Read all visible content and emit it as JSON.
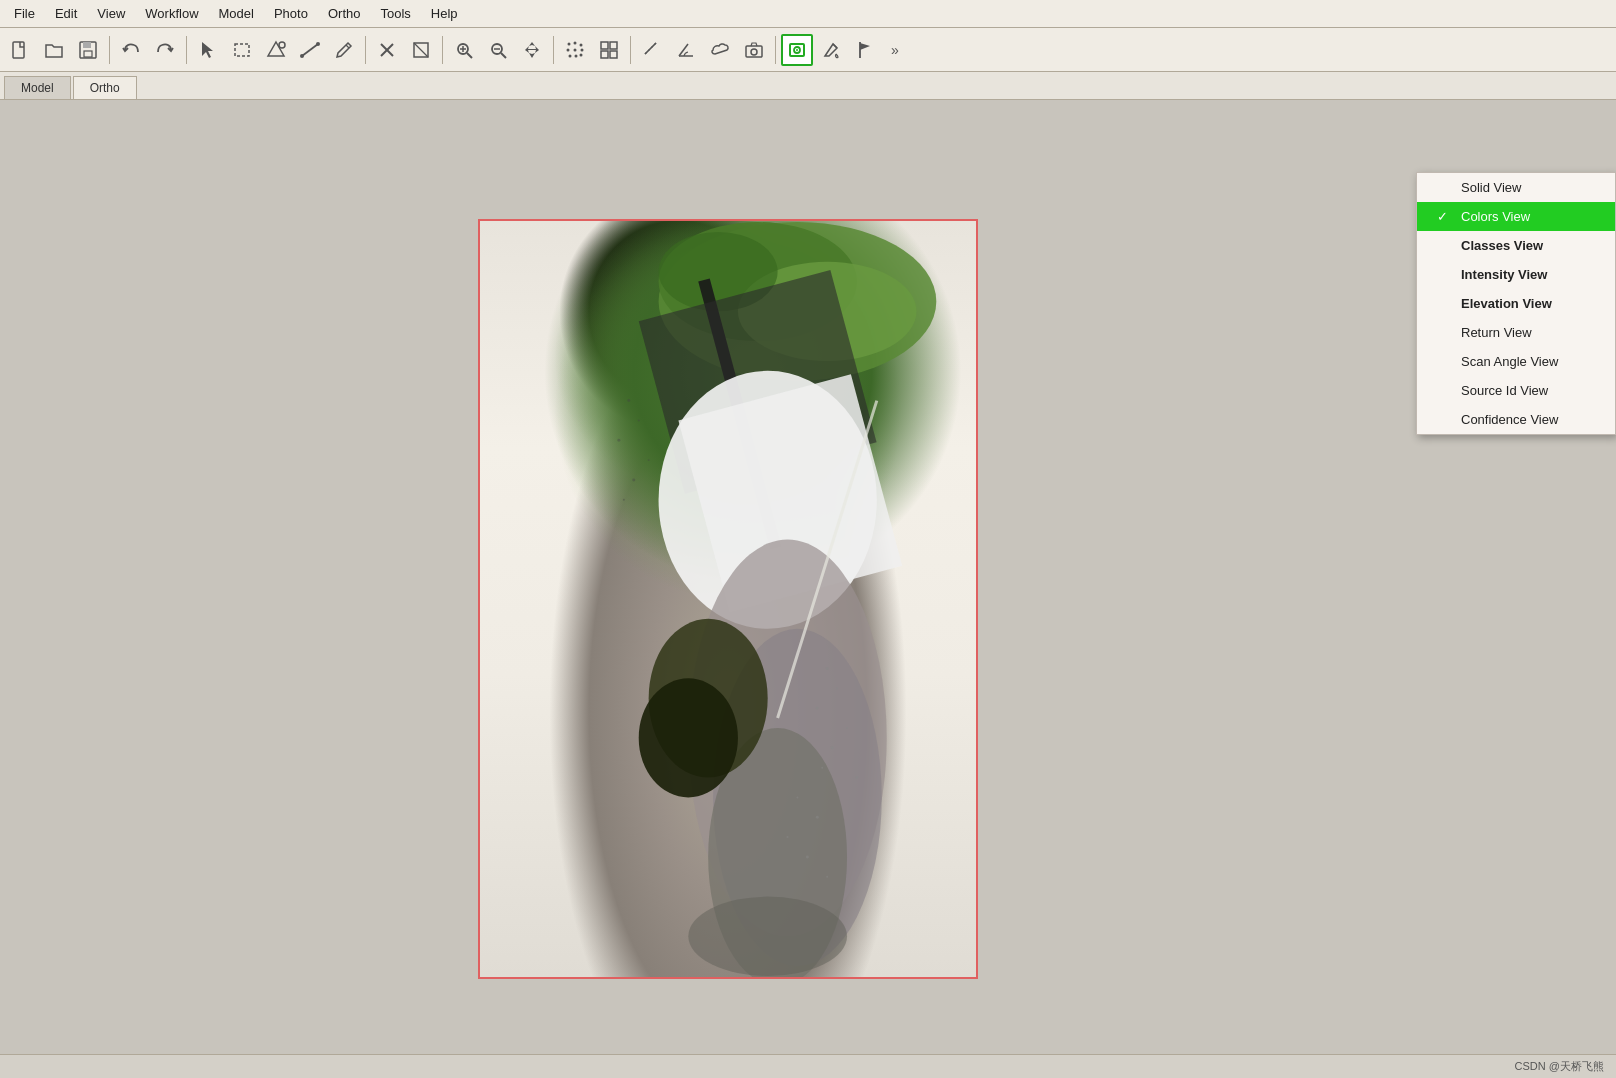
{
  "menubar": {
    "items": [
      "File",
      "Edit",
      "View",
      "Workflow",
      "Model",
      "Photo",
      "Ortho",
      "Tools",
      "Help"
    ]
  },
  "tabs": {
    "items": [
      "Model",
      "Ortho"
    ],
    "active": "Ortho"
  },
  "toolbar": {
    "buttons": [
      {
        "name": "new",
        "icon": "new-icon",
        "label": "New"
      },
      {
        "name": "open",
        "icon": "open-icon",
        "label": "Open"
      },
      {
        "name": "save",
        "icon": "save-icon",
        "label": "Save"
      },
      {
        "name": "undo",
        "icon": "undo-icon",
        "label": "Undo"
      },
      {
        "name": "redo",
        "icon": "redo-icon",
        "label": "Redo"
      },
      {
        "name": "select",
        "icon": "select-icon",
        "label": "Select"
      },
      {
        "name": "rect-select",
        "icon": "rect-select-icon",
        "label": "Rectangle Select"
      },
      {
        "name": "shape",
        "icon": "shape-icon",
        "label": "Shape"
      },
      {
        "name": "line",
        "icon": "line-icon",
        "label": "Line"
      },
      {
        "name": "pencil",
        "icon": "pencil-icon",
        "label": "Pencil"
      },
      {
        "name": "delete-pts",
        "icon": "delete-pts-icon",
        "label": "Delete Points"
      },
      {
        "name": "cut",
        "icon": "cut-icon",
        "label": "Cut"
      },
      {
        "name": "zoom-in",
        "icon": "zoom-in-icon",
        "label": "Zoom In"
      },
      {
        "name": "zoom-out",
        "icon": "zoom-out-icon",
        "label": "Zoom Out"
      },
      {
        "name": "pan",
        "icon": "pan-icon",
        "label": "Pan"
      },
      {
        "name": "points-view",
        "icon": "points-view-icon",
        "label": "Points"
      },
      {
        "name": "grid-view",
        "icon": "grid-view-icon",
        "label": "Grid"
      },
      {
        "name": "measure",
        "icon": "measure-icon",
        "label": "Measure"
      },
      {
        "name": "angle",
        "icon": "angle-icon",
        "label": "Angle"
      },
      {
        "name": "cloud",
        "icon": "cloud-icon",
        "label": "Cloud"
      },
      {
        "name": "photo",
        "icon": "photo-icon",
        "label": "Photo"
      },
      {
        "name": "3dview",
        "icon": "3dview-icon",
        "label": "3D View",
        "active": true
      },
      {
        "name": "paint",
        "icon": "paint-icon",
        "label": "Paint"
      },
      {
        "name": "flag",
        "icon": "flag-icon",
        "label": "Flag"
      }
    ]
  },
  "dropdown": {
    "items": [
      {
        "name": "solid-view",
        "label": "Solid View",
        "selected": false,
        "bold": true
      },
      {
        "name": "colors-view",
        "label": "Colors View",
        "selected": true,
        "bold": true
      },
      {
        "name": "classes-view",
        "label": "Classes View",
        "selected": false,
        "bold": true
      },
      {
        "name": "intensity-view",
        "label": "Intensity View",
        "selected": false,
        "bold": true
      },
      {
        "name": "elevation-view",
        "label": "Elevation View",
        "selected": false,
        "bold": true
      },
      {
        "name": "return-view",
        "label": "Return View",
        "selected": false,
        "bold": false
      },
      {
        "name": "scan-angle-view",
        "label": "Scan Angle View",
        "selected": false,
        "bold": false
      },
      {
        "name": "source-id-view",
        "label": "Source Id View",
        "selected": false,
        "bold": false
      },
      {
        "name": "confidence-view",
        "label": "Confidence View",
        "selected": false,
        "bold": false
      }
    ]
  },
  "statusbar": {
    "text": "CSDN @天桥飞熊"
  }
}
